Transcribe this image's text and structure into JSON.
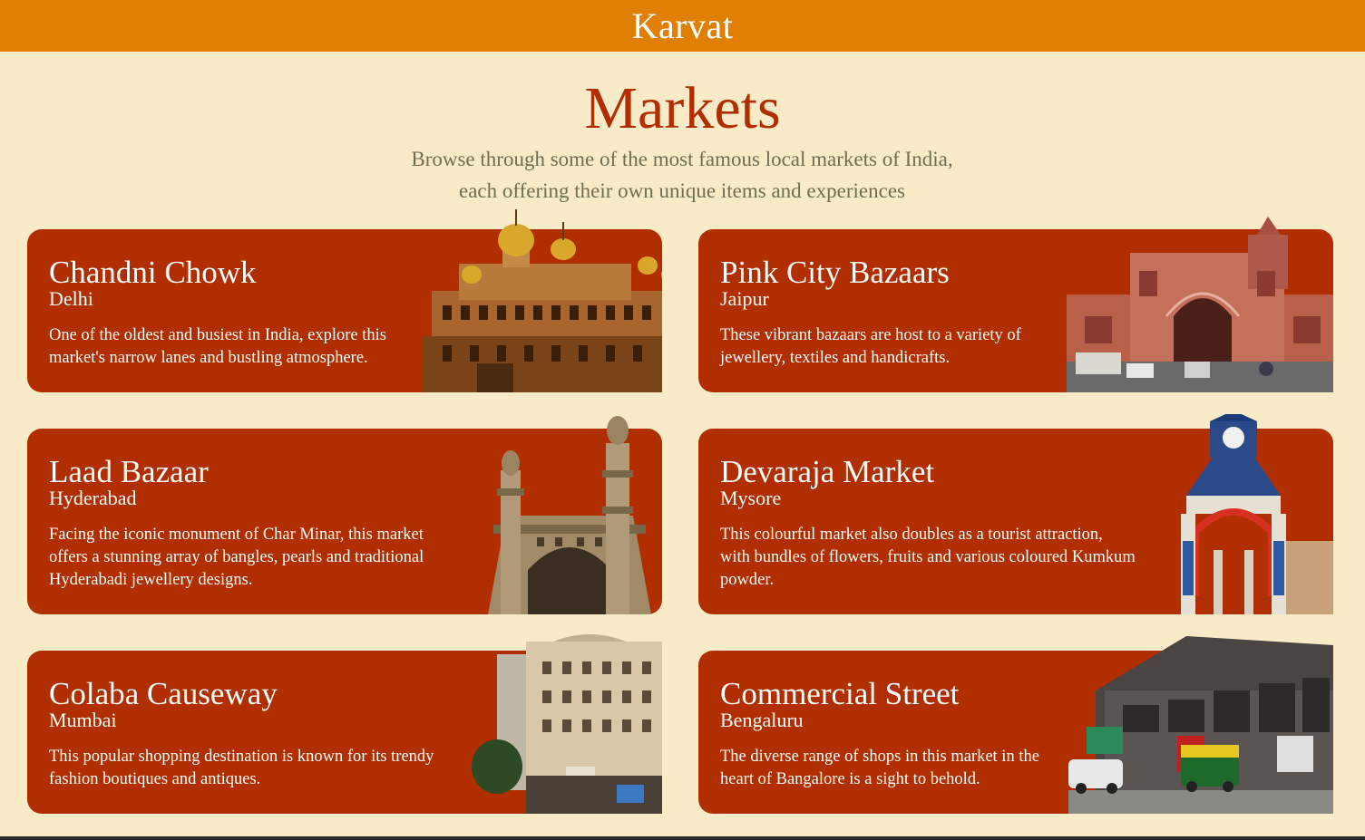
{
  "header": {
    "brand": "Karvat"
  },
  "page": {
    "title": "Markets",
    "subtitle_line1": "Browse through some of the most famous local markets of India,",
    "subtitle_line2": "each offering their own unique items and experiences"
  },
  "colors": {
    "header": "#e07f00",
    "card": "#b02e00",
    "background": "#f9ebc8"
  },
  "markets": [
    {
      "name": "Chandni Chowk",
      "city": "Delhi",
      "desc_line1": "One of the oldest and busiest in India, explore this",
      "desc_line2": "market's narrow lanes and bustling atmosphere.",
      "desc_line3": "",
      "image_icon": "gurudwara-building-icon"
    },
    {
      "name": "Pink City Bazaars",
      "city": "Jaipur",
      "desc_line1": "These vibrant bazaars are host to a variety of",
      "desc_line2": "jewellery, textiles and handicrafts.",
      "desc_line3": "",
      "image_icon": "pink-gate-icon"
    },
    {
      "name": "Laad Bazaar",
      "city": "Hyderabad",
      "desc_line1": "Facing the iconic monument of Char Minar, this market",
      "desc_line2": "offers a stunning array of bangles, pearls and traditional",
      "desc_line3": "Hyderabadi jewellery designs.",
      "image_icon": "charminar-icon"
    },
    {
      "name": "Devaraja Market",
      "city": "Mysore",
      "desc_line1": "This colourful market also doubles as a tourist attraction,",
      "desc_line2": "with bundles of flowers, fruits and various coloured Kumkum",
      "desc_line3": "powder.",
      "image_icon": "clock-tower-icon"
    },
    {
      "name": "Colaba Causeway",
      "city": "Mumbai",
      "desc_line1": "This popular shopping destination is known for its trendy",
      "desc_line2": "fashion boutiques and antiques.",
      "desc_line3": "",
      "image_icon": "colonial-building-icon"
    },
    {
      "name": "Commercial Street",
      "city": "Bengaluru",
      "desc_line1": "The diverse range of shops in this market in the",
      "desc_line2": "heart of Bangalore is a sight to behold.",
      "desc_line3": "",
      "image_icon": "shopping-mall-icon"
    }
  ]
}
